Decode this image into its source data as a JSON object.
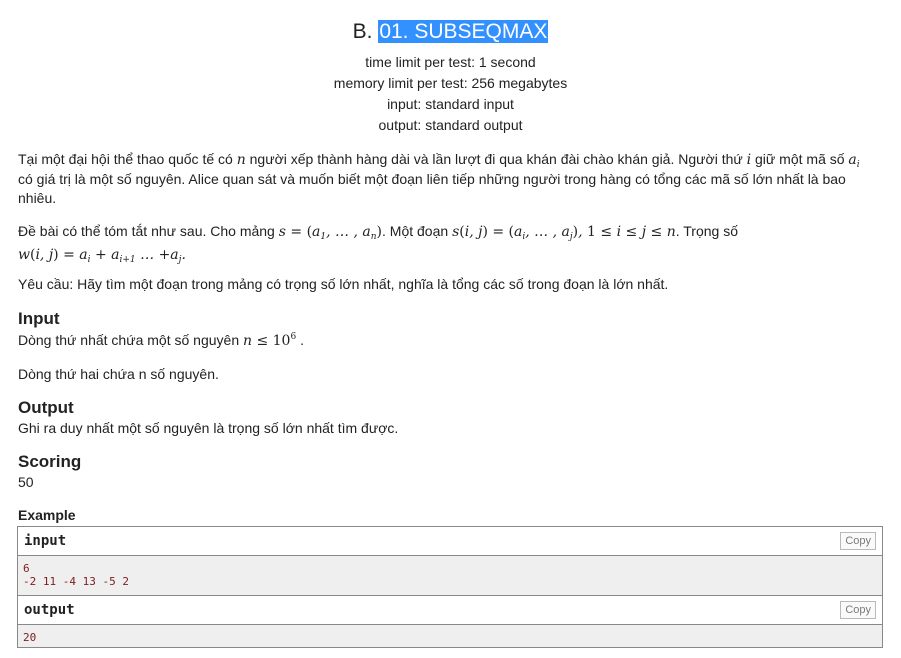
{
  "problem": {
    "letter": "B.",
    "name": "01. SUBSEQMAX",
    "time_limit": "time limit per test: 1 second",
    "memory_limit": "memory limit per test: 256 megabytes",
    "input": "input: standard input",
    "output": "output: standard output"
  },
  "statement": {
    "p1_a": "Tại một đại hội thể thao quốc tế có ",
    "p1_n": "n",
    "p1_b": " người xếp thành hàng dài và lần lượt đi qua khán đài chào khán giả. Người thứ ",
    "p1_i": "i",
    "p1_c": " giữ một mã số ",
    "p1_ai": "a",
    "p1_ai_sub": "i",
    "p1_d": "có giá trị là một số nguyên. Alice quan sát và muốn biết một đoạn liên tiếp những người trong hàng có tổng các mã số lớn nhất là bao nhiêu.",
    "p2_a": "Đề bài có thể tóm tắt như sau. Cho mảng ",
    "p2_b": ". Một đoạn ",
    "p2_c": ". Trọng số",
    "p3": "Yêu cầu: Hãy tìm một đoạn trong mảng có trọng số lớn nhất, nghĩa là tổng các số trong đoạn là lớn nhất."
  },
  "sections": {
    "input_title": "Input",
    "input_line1_a": "Dòng thứ nhất chứa một số nguyên ",
    "input_line1_b": ".",
    "input_line2": "Dòng thứ hai chứa n số nguyên.",
    "output_title": "Output",
    "output_text": "Ghi ra duy nhất một số nguyên là trọng số lớn nhất tìm được.",
    "scoring_title": "Scoring",
    "scoring_value": "50"
  },
  "example": {
    "title": "Example",
    "copy_label": "Copy",
    "input_label": "input",
    "input_data": "6\n-2 11 -4 13 -5 2",
    "output_label": "output",
    "output_data": "20"
  }
}
